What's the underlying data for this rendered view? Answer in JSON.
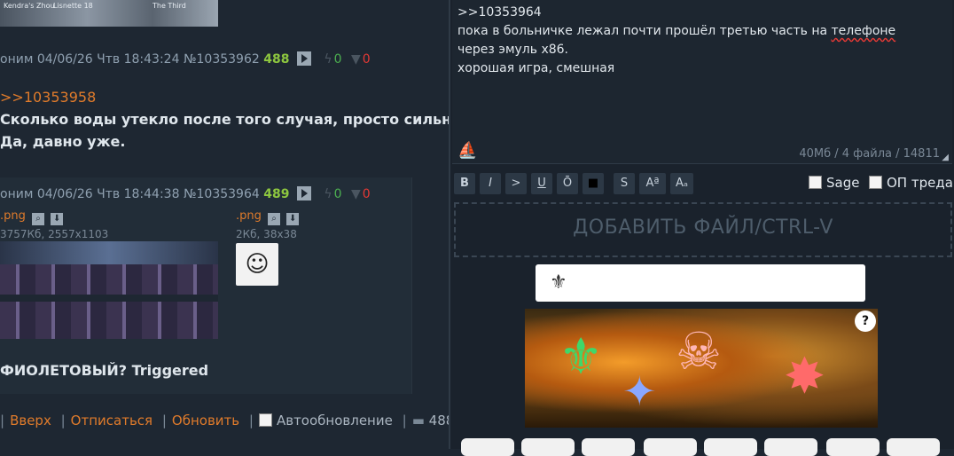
{
  "thread": {
    "top_thumb_texts": [
      "Kendra's Zhou",
      "Lisnette 18",
      "The Third"
    ],
    "post1": {
      "header": "оним 04/06/26 Чтв 18:43:24 №10353962",
      "count": "488",
      "likes": "0",
      "dislikes": "0",
      "reply": ">>10353958",
      "lines": [
        "Сколько воды утекло после того случая, просто сильно се",
        "Да, давно уже."
      ]
    },
    "post2": {
      "header": "оним 04/06/26 Чтв 18:44:38 №10353964",
      "count": "489",
      "likes": "0",
      "dislikes": "0",
      "file1_name": ".png",
      "file1_meta": "3757Кб, 2557x1103",
      "file2_name": ".png",
      "file2_meta": "2Кб, 38x38",
      "message": "ФИОЛЕТОВЫЙ? Triggered"
    },
    "footer": {
      "up": "Вверх",
      "unsubscribe": "Отписаться",
      "refresh": "Обновить",
      "autoupdate": "Автообновление",
      "count": "488"
    }
  },
  "reply_form": {
    "text_lines": [
      ">>10353964",
      "пока в больничке лежал почти прошёл третью часть на ",
      "через эмуль x86.",
      "хорошая игра, смешная"
    ],
    "misspelled": "телефоне",
    "stats": "40Мб / 4 файла / 14811",
    "format_buttons": [
      "B",
      "I",
      ">",
      "U",
      "Ō",
      "■",
      "S",
      "Aª",
      "Aₐ"
    ],
    "sage_label": "Sage",
    "op_label": "ОП треда",
    "dropzone_label": "ДОБАВИТЬ ФАЙЛ/CTRL-V",
    "captcha_help": "?"
  }
}
